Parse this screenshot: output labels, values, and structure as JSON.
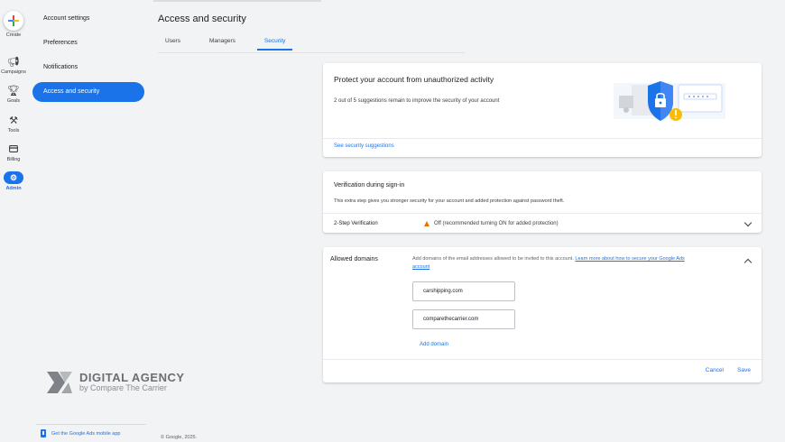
{
  "rail": {
    "create": "Create",
    "campaigns": "Campaigns",
    "goals": "Goals",
    "tools": "Tools",
    "billing": "Billing",
    "admin": "Admin"
  },
  "subnav": {
    "items": [
      {
        "label": "Account settings"
      },
      {
        "label": "Preferences"
      },
      {
        "label": "Notifications"
      },
      {
        "label": "Access and security"
      }
    ]
  },
  "header": {
    "title": "Access and security",
    "tabs": [
      {
        "label": "Users"
      },
      {
        "label": "Managers"
      },
      {
        "label": "Security"
      }
    ]
  },
  "protect": {
    "title": "Protect your account from unauthorized activity",
    "text": "2 out of 5 suggestions remain to improve the security of your account",
    "link": "See security suggestions"
  },
  "verification": {
    "title": "Verification during sign-in",
    "text": "This extra step gives you stronger security for your account and added protection against password theft.",
    "row_label": "2-Step Verification",
    "row_status": "Off (recommended turning ON for added protection)"
  },
  "domains": {
    "label": "Allowed domains",
    "desc": "Add domains of the email addresses allowed to be invited to this account. ",
    "desc_link": "Learn more about how to secure your Google Ads account",
    "items": [
      {
        "value": "carshipping.com"
      },
      {
        "value": "comparethecarrier.com"
      }
    ],
    "add": "Add domain",
    "cancel": "Cancel",
    "save": "Save"
  },
  "brand": {
    "name": "DIGITAL AGENCY",
    "sub": "by Compare The Carrier"
  },
  "footer": {
    "mobile_link": "Get the Google Ads mobile app",
    "copyright": "© Google, 2025."
  },
  "colors": {
    "accent": "#1a73e8",
    "warning": "#e37400",
    "background": "#f1f3f4"
  }
}
